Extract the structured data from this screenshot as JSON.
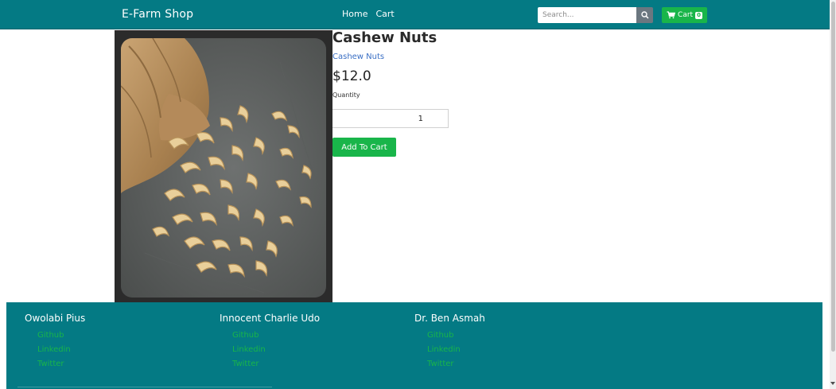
{
  "navbar": {
    "brand": "E-Farm Shop",
    "links": [
      "Home",
      "Cart"
    ],
    "search_placeholder": "Search...",
    "search_icon": "search-icon",
    "cart_label": "Cart",
    "cart_count": "0",
    "cart_icon": "shopping-cart-icon",
    "color": "#047a84"
  },
  "product": {
    "title": "Cashew Nuts",
    "subtitle": "Cashew Nuts",
    "price": "$12.0",
    "quantity_label": "Quantity",
    "quantity_value": "1",
    "add_to_cart_label": "Add To Cart"
  },
  "footer": {
    "columns": [
      {
        "name": "Owolabi Pius",
        "links": [
          "Github",
          "Linkedin",
          "Twitter"
        ]
      },
      {
        "name": "Innocent Charlie Udo",
        "links": [
          "Github",
          "Linkedin",
          "Twitter"
        ]
      },
      {
        "name": "Dr. Ben Asmah",
        "links": [
          "Github",
          "Linkedin",
          "Twitter"
        ]
      }
    ]
  },
  "colors": {
    "primary": "#047a84",
    "success": "#19b54a",
    "link": "#3a6fc4"
  }
}
